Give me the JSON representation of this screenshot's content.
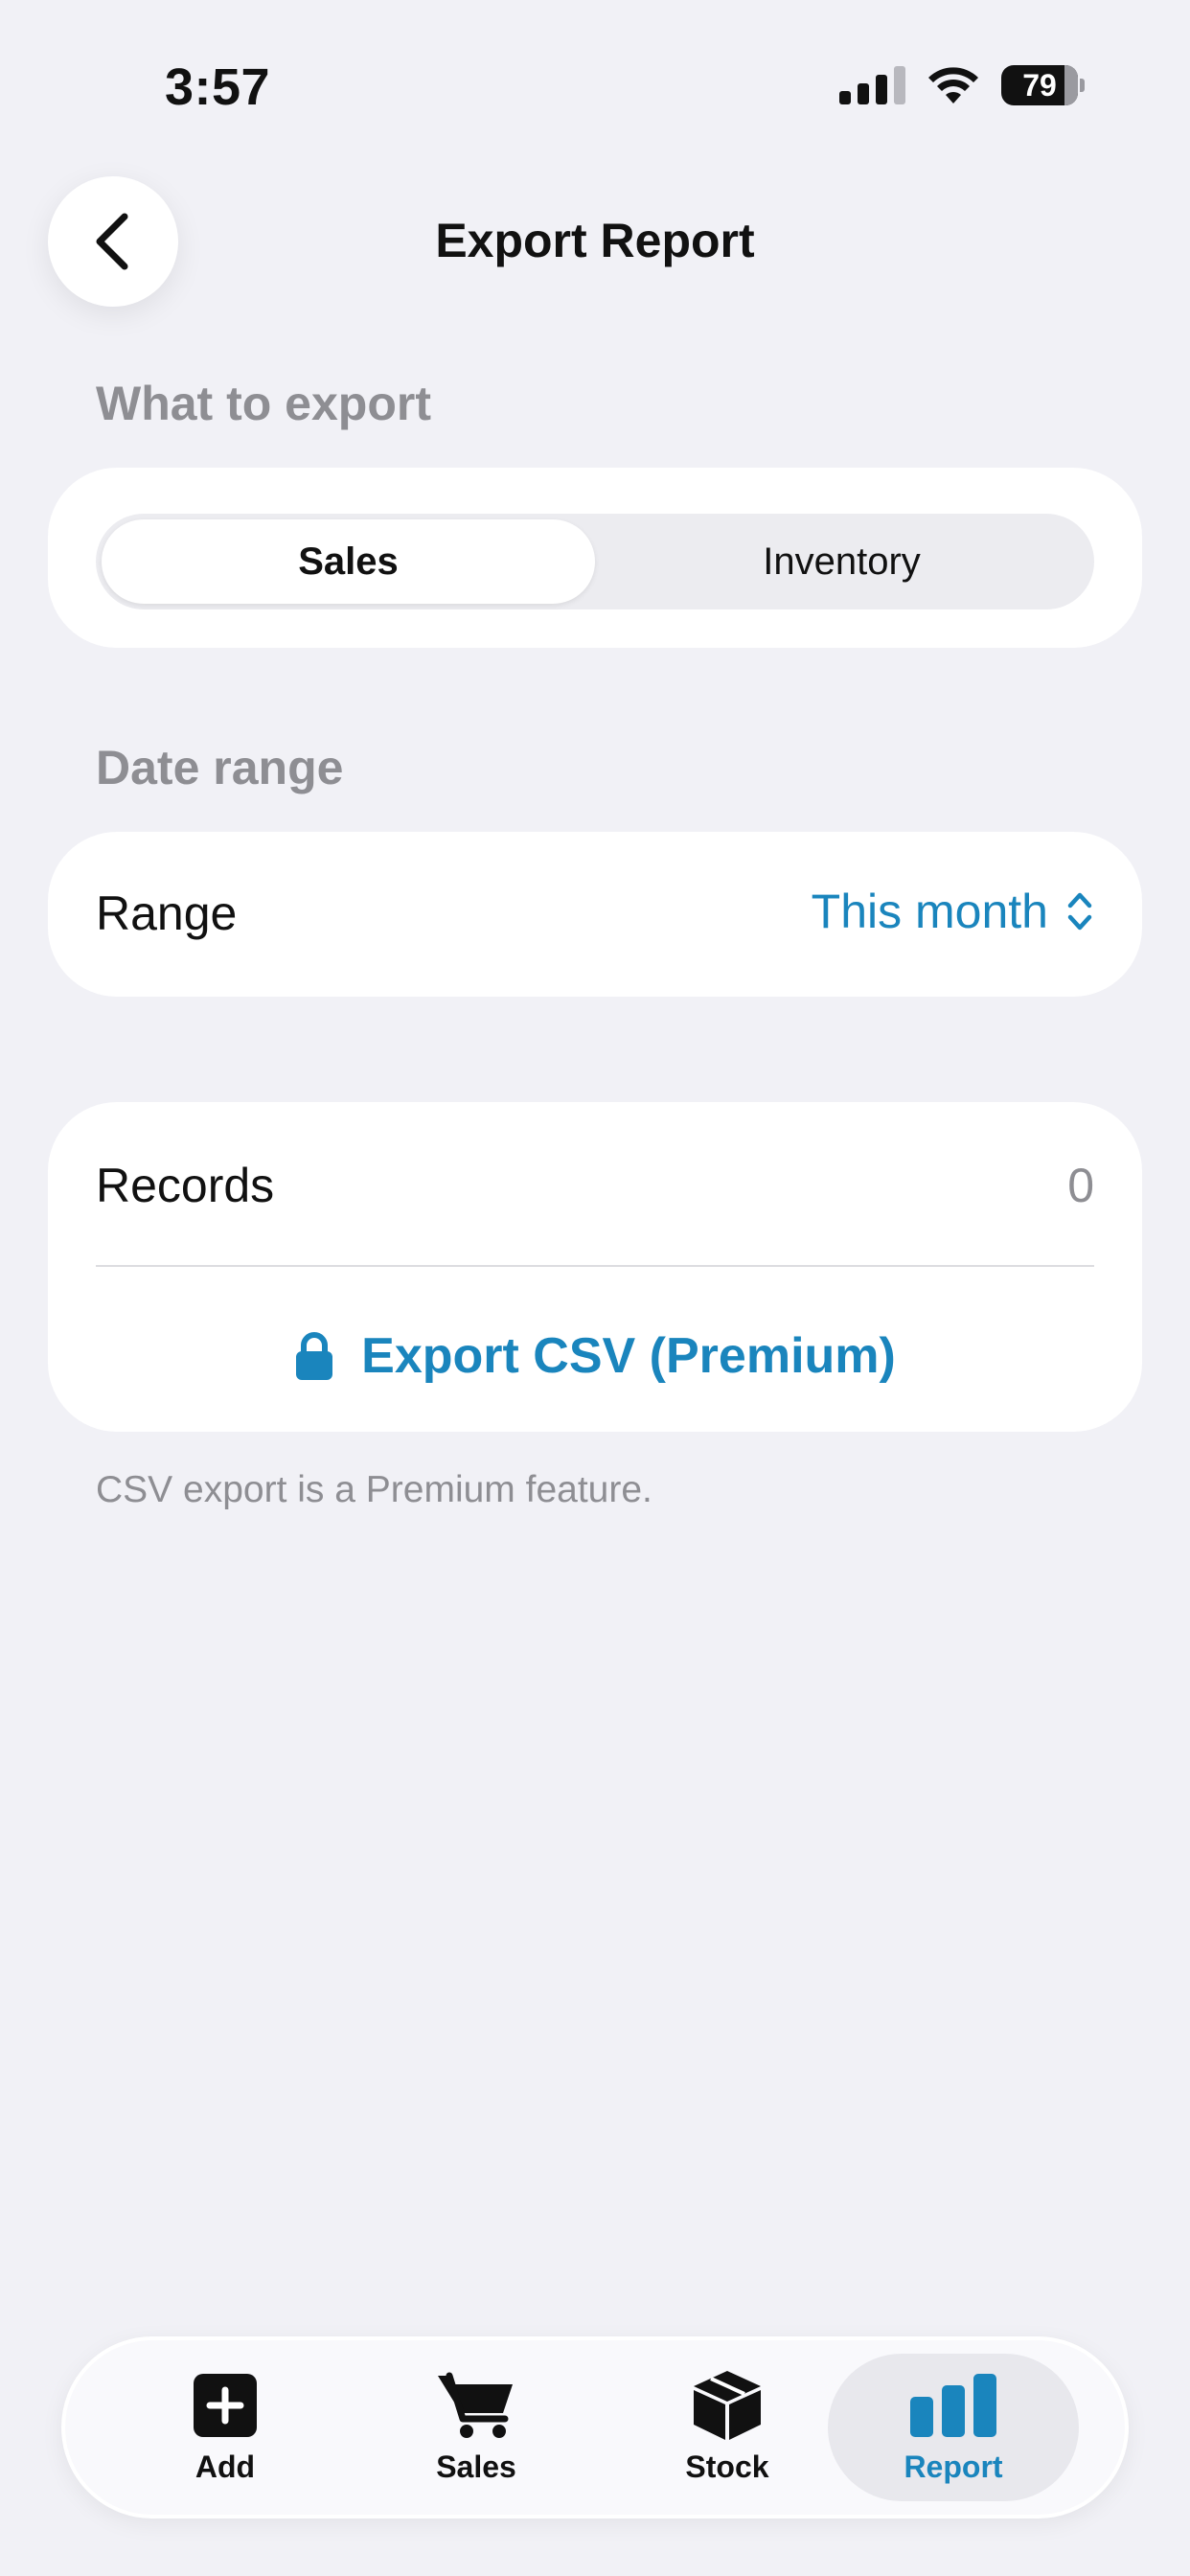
{
  "status_bar": {
    "time": "3:57",
    "battery": "79"
  },
  "nav": {
    "title": "Export Report"
  },
  "export_type": {
    "label": "What to export",
    "options": [
      "Sales",
      "Inventory"
    ],
    "selected": "Sales"
  },
  "date_range": {
    "label": "Date range",
    "row_label": "Range",
    "value": "This month"
  },
  "records": {
    "label": "Records",
    "count": "0"
  },
  "export_button": {
    "label": "Export CSV (Premium)"
  },
  "footnote": "CSV export is a Premium feature.",
  "tabbar": {
    "items": [
      {
        "label": "Add",
        "icon": "plus-square-icon"
      },
      {
        "label": "Sales",
        "icon": "cart-icon"
      },
      {
        "label": "Stock",
        "icon": "box-icon"
      },
      {
        "label": "Report",
        "icon": "bar-chart-icon"
      }
    ],
    "active": "Report"
  },
  "colors": {
    "accent": "#1a85bd",
    "background": "#f1f1f6",
    "secondary_text": "#8e8e93"
  }
}
